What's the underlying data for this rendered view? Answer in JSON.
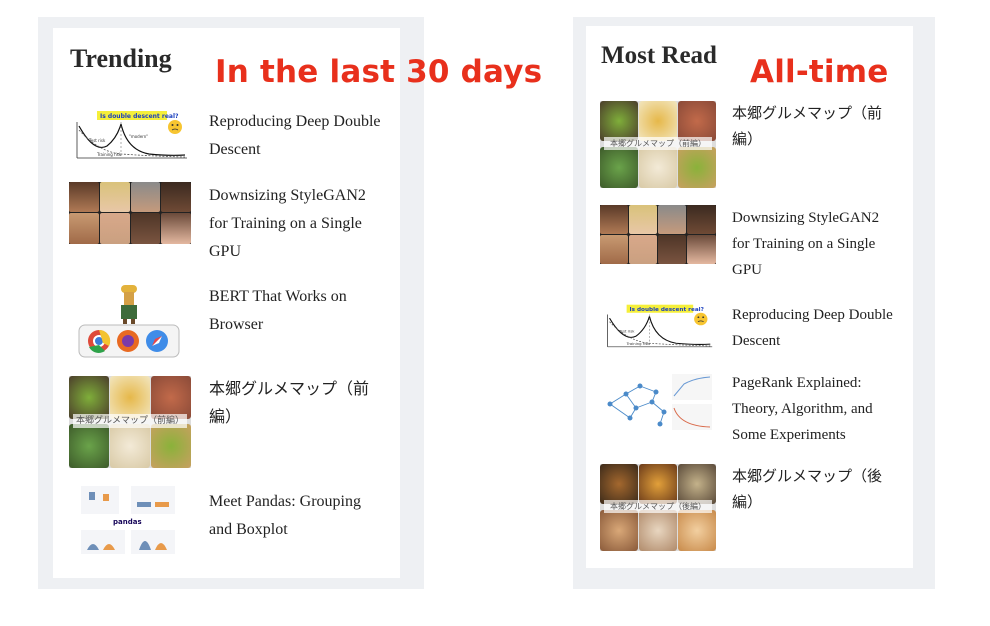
{
  "trending": {
    "title": "Trending",
    "annotation": "In the last 30 days",
    "items": [
      {
        "title": "Reproducing Deep Double Descent",
        "thumb": "double-descent-plot",
        "thumb_caption": "Is double descent real?"
      },
      {
        "title": "Downsizing StyleGAN2 for Training on a Single GPU",
        "thumb": "face-grid"
      },
      {
        "title": "BERT That Works on Browser",
        "thumb": "browser-icons"
      },
      {
        "title": "本郷グルメマップ（前編）",
        "thumb": "food-collage",
        "thumb_caption": "本郷グルメマップ（前編）"
      },
      {
        "title": "Meet Pandas: Grouping and Boxplot",
        "thumb": "pandas-boxplot",
        "thumb_caption": "pandas"
      }
    ]
  },
  "most_read": {
    "title": "Most Read",
    "annotation": "All-time",
    "items": [
      {
        "title": "本郷グルメマップ（前編）",
        "thumb": "food-collage",
        "thumb_caption": "本郷グルメマップ（前編）"
      },
      {
        "title": "Downsizing StyleGAN2 for Training on a Single GPU",
        "thumb": "face-grid"
      },
      {
        "title": "Reproducing Deep Double Descent",
        "thumb": "double-descent-plot",
        "thumb_caption": "Is double descent real?"
      },
      {
        "title": "PageRank Explained: Theory, Algorithm, and Some Experiments",
        "thumb": "graph-network"
      },
      {
        "title": "本郷グルメマップ（後編）",
        "thumb": "food-collage",
        "thumb_caption": "本郷グルメマップ（後編）"
      }
    ]
  }
}
